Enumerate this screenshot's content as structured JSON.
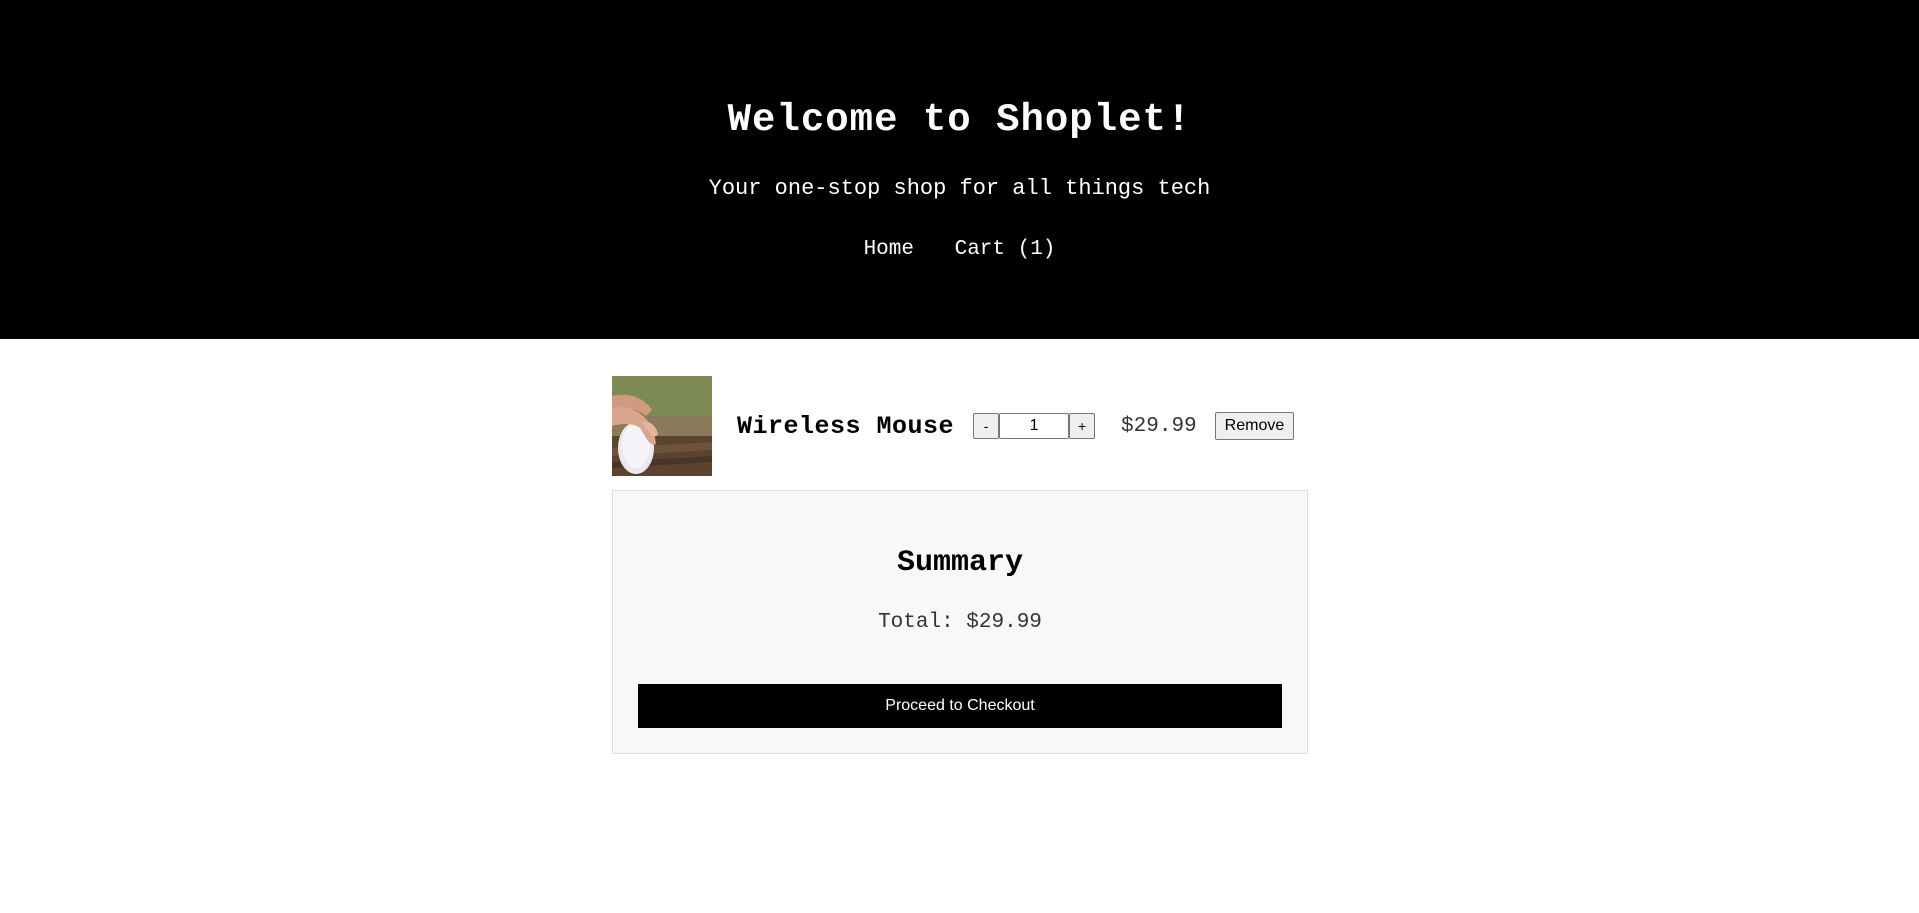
{
  "header": {
    "title": "Welcome to Shoplet!",
    "tagline": "Your one-stop shop for all things tech",
    "nav": {
      "home_label": "Home",
      "cart_label": "Cart (1)"
    }
  },
  "cart": {
    "items": [
      {
        "name": "Wireless Mouse",
        "image_icon": "mouse-product-photo",
        "quantity": "1",
        "decrement_label": "-",
        "increment_label": "+",
        "price": "$29.99",
        "remove_label": "Remove"
      }
    ]
  },
  "summary": {
    "heading": "Summary",
    "total": "Total: $29.99",
    "checkout_label": "Proceed to Checkout"
  },
  "colors": {
    "header_bg": "#000000",
    "summary_bg": "#f8f8f8",
    "checkout_bg": "#000000"
  }
}
